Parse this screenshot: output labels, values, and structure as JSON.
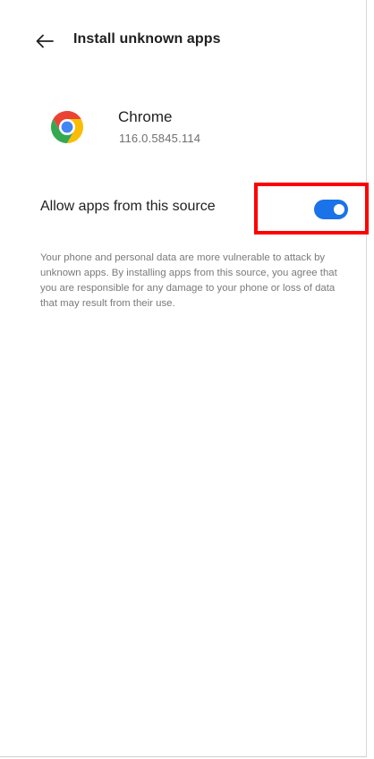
{
  "header": {
    "back_icon": "arrow-left-icon",
    "title": "Install unknown apps"
  },
  "app": {
    "icon": "chrome-icon",
    "name": "Chrome",
    "version": "116.0.5845.114"
  },
  "setting": {
    "label": "Allow apps from this source",
    "enabled": true,
    "toggle_color": "#1a73e8",
    "highlight_color": "#ff0000"
  },
  "disclaimer": "Your phone and personal data are more vulnerable to attack by unknown apps. By installing apps from this source, you agree that you are responsible for any damage to your phone or loss of data that may result from their use."
}
